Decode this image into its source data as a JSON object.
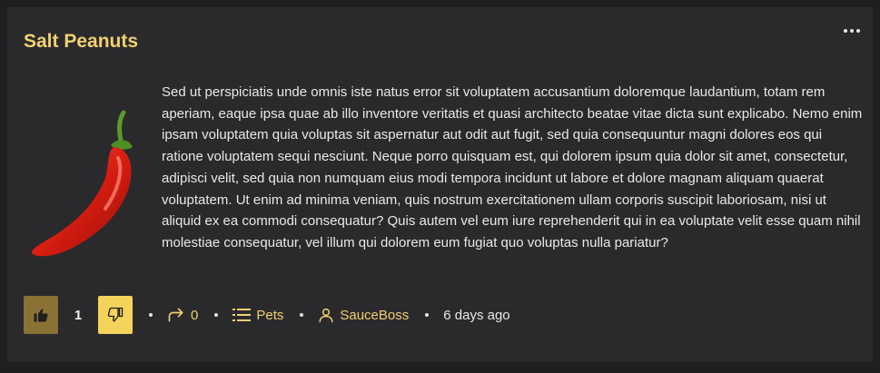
{
  "post": {
    "title": "Salt Peanuts",
    "body": "Sed ut perspiciatis unde omnis iste natus error sit voluptatem accusantium doloremque laudantium, totam rem aperiam, eaque ipsa quae ab illo inventore veritatis et quasi architecto beatae vitae dicta sunt explicabo. Nemo enim ipsam voluptatem quia voluptas sit aspernatur aut odit aut fugit, sed quia consequuntur magni dolores eos qui ratione voluptatem sequi nesciunt. Neque porro quisquam est, qui dolorem ipsum quia dolor sit amet, consectetur, adipisci velit, sed quia non numquam eius modi tempora incidunt ut labore et dolore magnam aliquam quaerat voluptatem. Ut enim ad minima veniam, quis nostrum exercitationem ullam corporis suscipit laboriosam, nisi ut aliquid ex ea commodi consequatur? Quis autem vel eum iure reprehenderit qui in ea voluptate velit esse quam nihil molestiae consequatur, vel illum qui dolorem eum fugiat quo voluptas nulla pariatur?",
    "thumbnail_icon": "chili-pepper-icon"
  },
  "footer": {
    "score": "1",
    "share_count": "0",
    "community": "Pets",
    "author": "SauceBoss",
    "age": "6 days ago"
  },
  "icons": {
    "more": "more-horizontal-icon",
    "upvote": "thumbs-up-icon",
    "downvote": "thumbs-down-icon",
    "share": "share-arrow-icon",
    "community": "list-icon",
    "author": "user-icon"
  },
  "colors": {
    "accent": "#f0d070",
    "upvote_bg": "#8a7234",
    "downvote_bg": "#f4d35a",
    "card_bg": "#2a2a2d",
    "page_bg": "#1f1f22"
  }
}
